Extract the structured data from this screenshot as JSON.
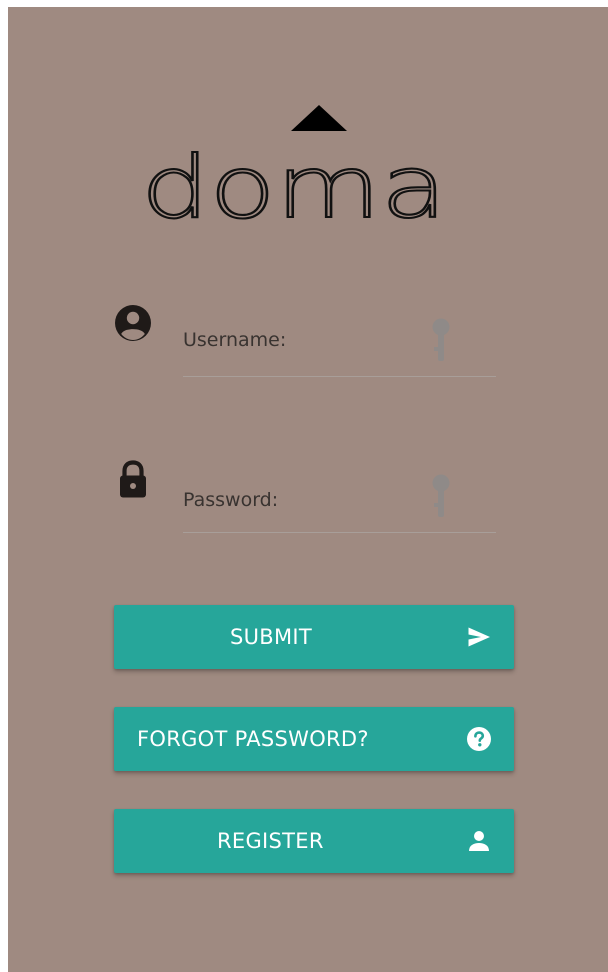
{
  "logo": {
    "text": "doma",
    "letters": [
      "d",
      "o",
      "m",
      "a"
    ]
  },
  "form": {
    "username": {
      "placeholder": "Username:",
      "value": "",
      "icon": "user-circle-icon",
      "suffix_icon": "key-icon"
    },
    "password": {
      "placeholder": "Password:",
      "value": "",
      "icon": "lock-icon",
      "suffix_icon": "key-icon"
    }
  },
  "buttons": {
    "submit": {
      "label": "SUBMIT",
      "icon": "send-icon"
    },
    "forgot": {
      "label": "FORGOT PASSWORD?",
      "icon": "question-circle-icon"
    },
    "register": {
      "label": "REGISTER",
      "icon": "user-icon"
    }
  },
  "colors": {
    "background": "#9f8a81",
    "button": "#26a69a",
    "button_text": "#ffffff",
    "icon": "#1f1a18",
    "key_icon": "#8f8a88"
  }
}
